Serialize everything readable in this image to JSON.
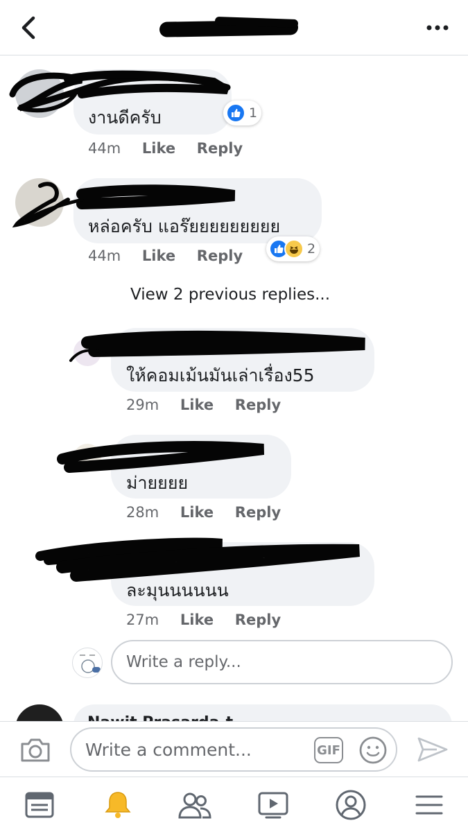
{
  "comments": [
    {
      "text": "งานดีครับ",
      "time": "44m",
      "like": "Like",
      "reply": "Reply",
      "reaction_count": "1"
    },
    {
      "text": "หล่อครับ แอร๊ยยยยยยยยย",
      "time": "44m",
      "like": "Like",
      "reply": "Reply",
      "reaction_count": "2"
    }
  ],
  "view_previous": "View 2 previous replies...",
  "replies": [
    {
      "text": "ให้คอมเม้นมันเล่าเรื่อง55",
      "time": "29m",
      "like": "Like",
      "reply": "Reply"
    },
    {
      "text": "ม่ายยยย",
      "time": "28m",
      "like": "Like",
      "reply": "Reply"
    },
    {
      "text": "ละมุนนนนนน",
      "time": "27m",
      "like": "Like",
      "reply": "Reply"
    }
  ],
  "reply_input": {
    "placeholder": "Write a reply..."
  },
  "composer": {
    "placeholder": "Write a comment...",
    "gif_label": "GIF"
  },
  "partial_next_author": "Nawit Prasarda-t",
  "icons": {
    "back": "back-chevron-icon",
    "more": "more-dots-icon",
    "camera": "camera-icon",
    "emoji": "emoji-icon",
    "send": "send-icon",
    "tabs": [
      "news-feed-icon",
      "notifications-icon",
      "friends-icon",
      "watch-icon",
      "profile-icon",
      "menu-icon"
    ]
  },
  "colors": {
    "like_blue": "#1877f2",
    "haha_yellow": "#f7c94b",
    "active_tab": "#f7b928",
    "meta_gray": "#65676b"
  }
}
